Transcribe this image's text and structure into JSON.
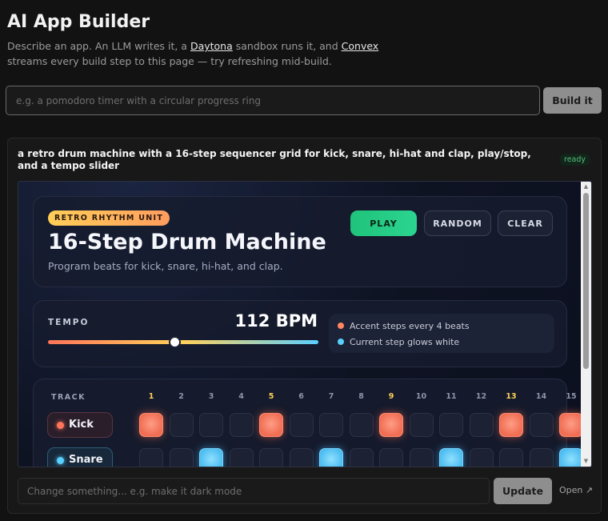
{
  "header": {
    "title": "AI App Builder",
    "desc_1": "Describe an app. An LLM writes it, a ",
    "link_daytona": "Daytona",
    "desc_2": " sandbox runs it, and ",
    "link_convex": "Convex",
    "desc_3": " streams every build step to this page — try refreshing mid-build."
  },
  "prompt": {
    "placeholder": "e.g. a pomodoro timer with a circular progress ring",
    "button_label": "Build it"
  },
  "card": {
    "prompt_text": "a retro drum machine with a 16-step sequencer grid for kick, snare, hi-hat and clap, play/stop, and a tempo slider",
    "status": "ready",
    "update_placeholder": "Change something... e.g. make it dark mode",
    "update_label": "Update",
    "open_label": "Open ↗"
  },
  "app": {
    "badge": "RETRO RHYTHM UNIT",
    "title": "16-Step Drum Machine",
    "subtitle": "Program beats for kick, snare, hi-hat, and clap.",
    "buttons": {
      "play": "PLAY",
      "random": "RANDOM",
      "clear": "CLEAR"
    },
    "tempo": {
      "label": "TEMPO",
      "value_text": "112 BPM",
      "slider_fraction": 0.47,
      "legend": [
        {
          "text": "Accent steps every 4 beats",
          "color": "#ff8660"
        },
        {
          "text": "Current step glows white",
          "color": "#5ad0ff"
        }
      ]
    },
    "grid": {
      "track_header": "TRACK",
      "steps": [
        "1",
        "2",
        "3",
        "4",
        "5",
        "6",
        "7",
        "8",
        "9",
        "10",
        "11",
        "12",
        "13",
        "14",
        "15"
      ],
      "accent_steps": [
        "1",
        "5",
        "9",
        "13"
      ],
      "tracks": [
        {
          "name": "Kick",
          "color": "#ff7559",
          "active": [
            1,
            5,
            9,
            13,
            15
          ]
        },
        {
          "name": "Snare",
          "color": "#5ad0ff",
          "active": [
            3,
            7,
            11,
            15
          ]
        }
      ]
    }
  },
  "colors": {
    "background": "#121212",
    "accent_play": "#20c37a",
    "kick": "#f06e54",
    "snare": "#4cbcf0",
    "ready": "#55c07a"
  }
}
